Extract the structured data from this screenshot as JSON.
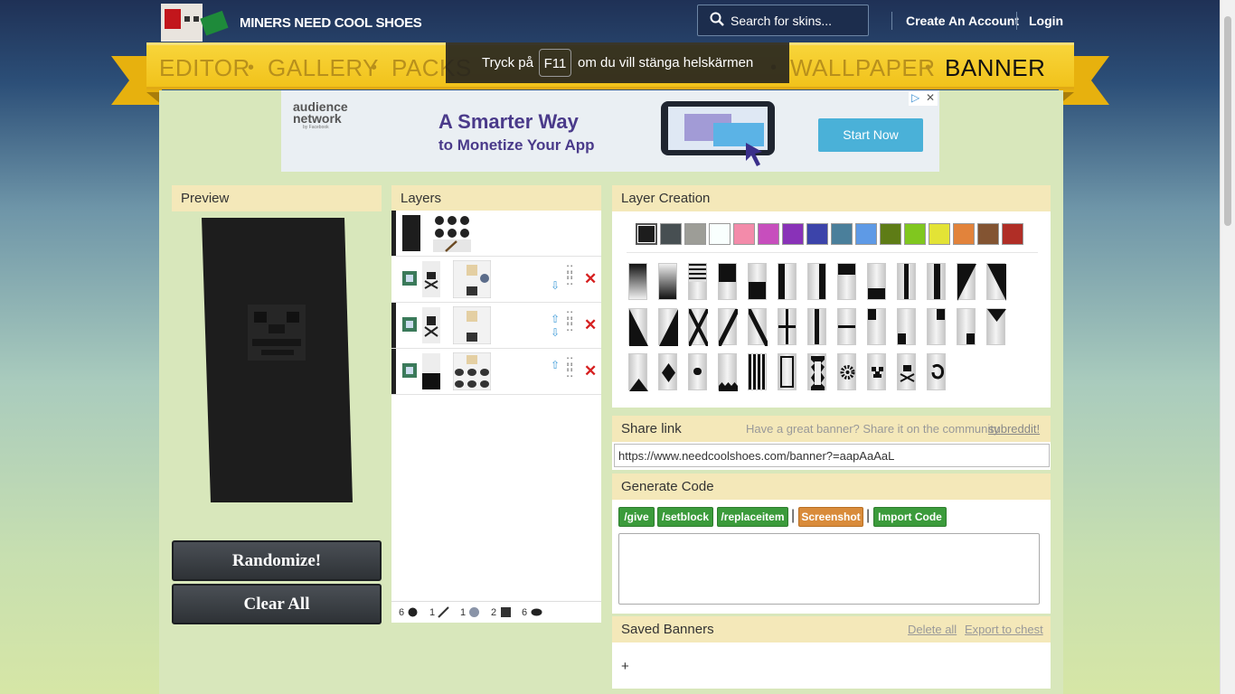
{
  "site": {
    "name": "MINERS NEED COOL SHOES"
  },
  "search": {
    "placeholder": "Search for skins..."
  },
  "account": {
    "create": "Create An Account",
    "login": "Login"
  },
  "nav": {
    "editor": "EDITOR",
    "gallery": "GALLERY",
    "packs": "PACKS",
    "wallpaper": "WALLPAPER",
    "banner": "BANNER"
  },
  "fullscreen_notice": {
    "before": "Tryck på",
    "key": "F11",
    "after": "om du vill stänga helskärmen"
  },
  "ad": {
    "brand": "audience network",
    "brand_sub": "by Facebook",
    "headline": "A Smarter Way",
    "subline": "to Monetize Your App",
    "cta": "Start Now"
  },
  "preview": {
    "title": "Preview"
  },
  "buttons": {
    "randomize": "Randomize!",
    "clear_all": "Clear All"
  },
  "layers": {
    "title": "Layers",
    "rows": [
      {
        "id": "base"
      },
      {
        "id": "skull",
        "up": false,
        "down": true
      },
      {
        "id": "creeper",
        "up": true,
        "down": true
      },
      {
        "id": "bottom",
        "up": true,
        "down": false
      }
    ]
  },
  "counts": [
    {
      "n": "6",
      "item": "ink-sac"
    },
    {
      "n": "1",
      "item": "stick"
    },
    {
      "n": "1",
      "item": "wither-skull"
    },
    {
      "n": "2",
      "item": "creeper-head"
    },
    {
      "n": "6",
      "item": "ink"
    }
  ],
  "layer_creation": {
    "title": "Layer Creation",
    "colors": [
      "#1d1d1d",
      "#474f52",
      "#9d9d97",
      "#f9fffe",
      "#f38baa",
      "#c74ebd",
      "#8932b8",
      "#3c44aa",
      "#4a7f9b",
      "#5e9ae6",
      "#5e7c16",
      "#80c71f",
      "#e3e336",
      "#e2833b",
      "#835432",
      "#b02e26"
    ],
    "selected_color": "#1d1d1d"
  },
  "share": {
    "title": "Share link",
    "prompt": "Have a great banner? Share it on the community",
    "link_text": "subreddit!",
    "url": "https://www.needcoolshoes.com/banner?=aapAaAaL"
  },
  "generate": {
    "title": "Generate Code",
    "give": "/give",
    "setblock": "/setblock",
    "replaceitem": "/replaceitem",
    "screenshot": "Screenshot",
    "import": "Import Code",
    "sep": "|"
  },
  "saved": {
    "title": "Saved Banners",
    "delete_all": "Delete all",
    "export": "Export to chest",
    "add": "+"
  }
}
